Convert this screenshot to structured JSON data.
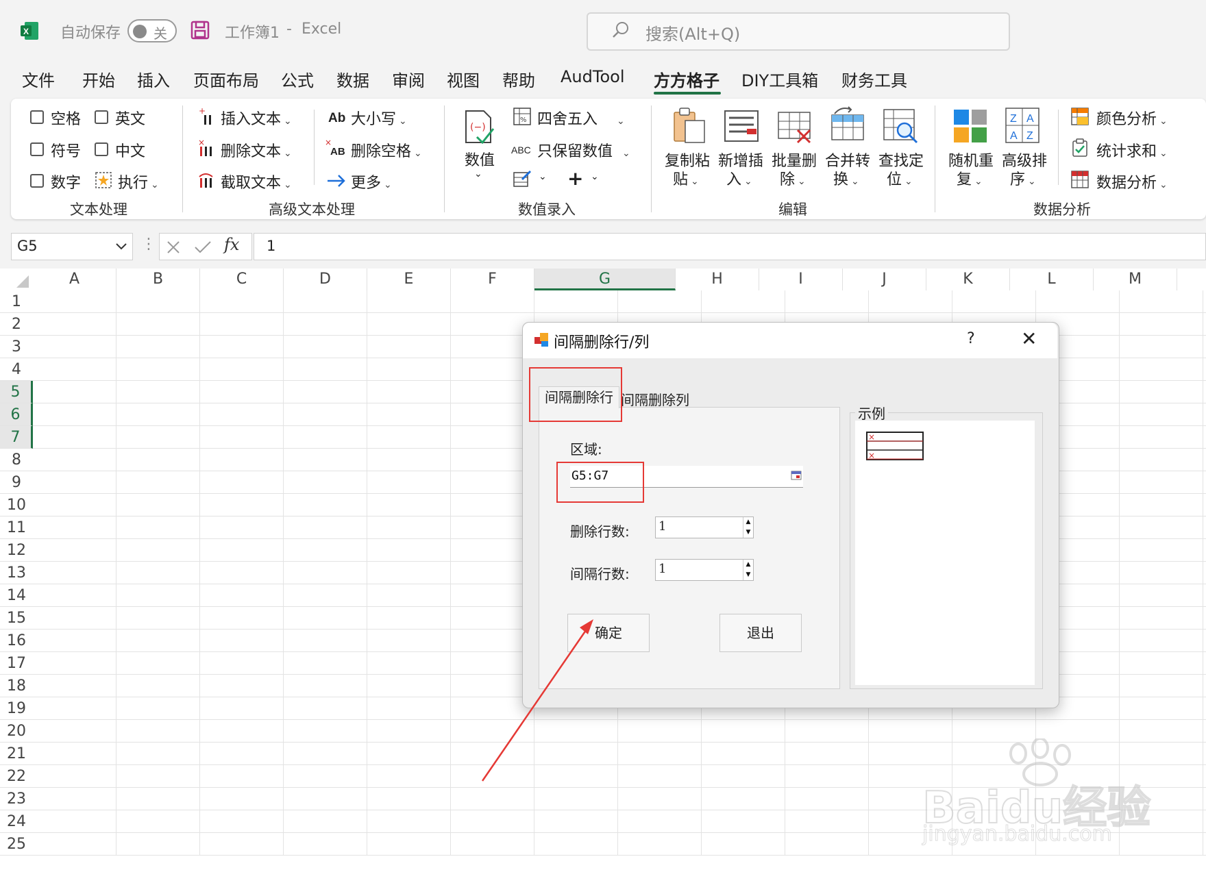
{
  "titlebar": {
    "autosave_label": "自动保存",
    "autosave_state": "关",
    "doc_title": "工作簿1",
    "separator": "-",
    "app_name": "Excel",
    "search_placeholder": "搜索(Alt+Q)"
  },
  "menu": {
    "items": [
      "文件",
      "开始",
      "插入",
      "页面布局",
      "公式",
      "数据",
      "审阅",
      "视图",
      "帮助",
      "AudTool",
      "方方格子",
      "DIY工具箱",
      "财务工具"
    ],
    "active": "方方格子"
  },
  "ribbon": {
    "text_processing": {
      "checkboxes": [
        "空格",
        "英文",
        "符号",
        "中文",
        "数字"
      ],
      "execute": "执行",
      "label": "文本处理"
    },
    "advanced_text": {
      "insert_text": "插入文本",
      "delete_text": "删除文本",
      "extract_text": "截取文本",
      "case": "大小写",
      "delete_spaces": "删除空格",
      "more": "更多",
      "label": "高级文本处理"
    },
    "numeric": {
      "value": "数值",
      "round": "四舍五入",
      "keep_numbers": "只保留数值",
      "label": "数值录入"
    },
    "edit": {
      "copy_paste_1": "复制粘",
      "copy_paste_2": "贴",
      "insert_1": "新增插",
      "insert_2": "入",
      "batch_delete_1": "批量删",
      "batch_delete_2": "除",
      "merge_1": "合并转",
      "merge_2": "换",
      "locate_1": "查找定",
      "locate_2": "位",
      "label": "编辑"
    },
    "analysis": {
      "random_1": "随机重",
      "random_2": "复",
      "sort_1": "高级排",
      "sort_2": "序",
      "color_analysis": "颜色分析",
      "stats_sum": "统计求和",
      "data_analysis": "数据分析",
      "label": "数据分析"
    }
  },
  "formula_bar": {
    "name_box": "G5",
    "formula": "1"
  },
  "grid": {
    "columns": [
      "A",
      "B",
      "C",
      "D",
      "E",
      "F",
      "G",
      "H",
      "I",
      "J",
      "K",
      "L",
      "M"
    ],
    "selected_column": "G",
    "rows": [
      "1",
      "2",
      "3",
      "4",
      "5",
      "6",
      "7",
      "8",
      "9",
      "10",
      "11",
      "12",
      "13",
      "14",
      "15",
      "16",
      "17",
      "18",
      "19",
      "20",
      "21",
      "22",
      "23",
      "24",
      "25"
    ],
    "selected_rows": [
      "5",
      "6",
      "7"
    ]
  },
  "dialog": {
    "title": "间隔删除行/列",
    "help": "?",
    "tab_rows": "间隔删除行",
    "tab_cols": "间隔删除列",
    "area_label": "区域:",
    "area_value": "G5:G7",
    "delete_rows_label": "删除行数:",
    "delete_rows_value": "1",
    "interval_rows_label": "间隔行数:",
    "interval_rows_value": "1",
    "ok_button": "确定",
    "exit_button": "退出",
    "example_label": "示例"
  },
  "watermark": {
    "brand": "Baidu经验",
    "url": "jingyan.baidu.com"
  },
  "colors": {
    "excel_green": "#217346",
    "annotation_red": "#e53935"
  }
}
